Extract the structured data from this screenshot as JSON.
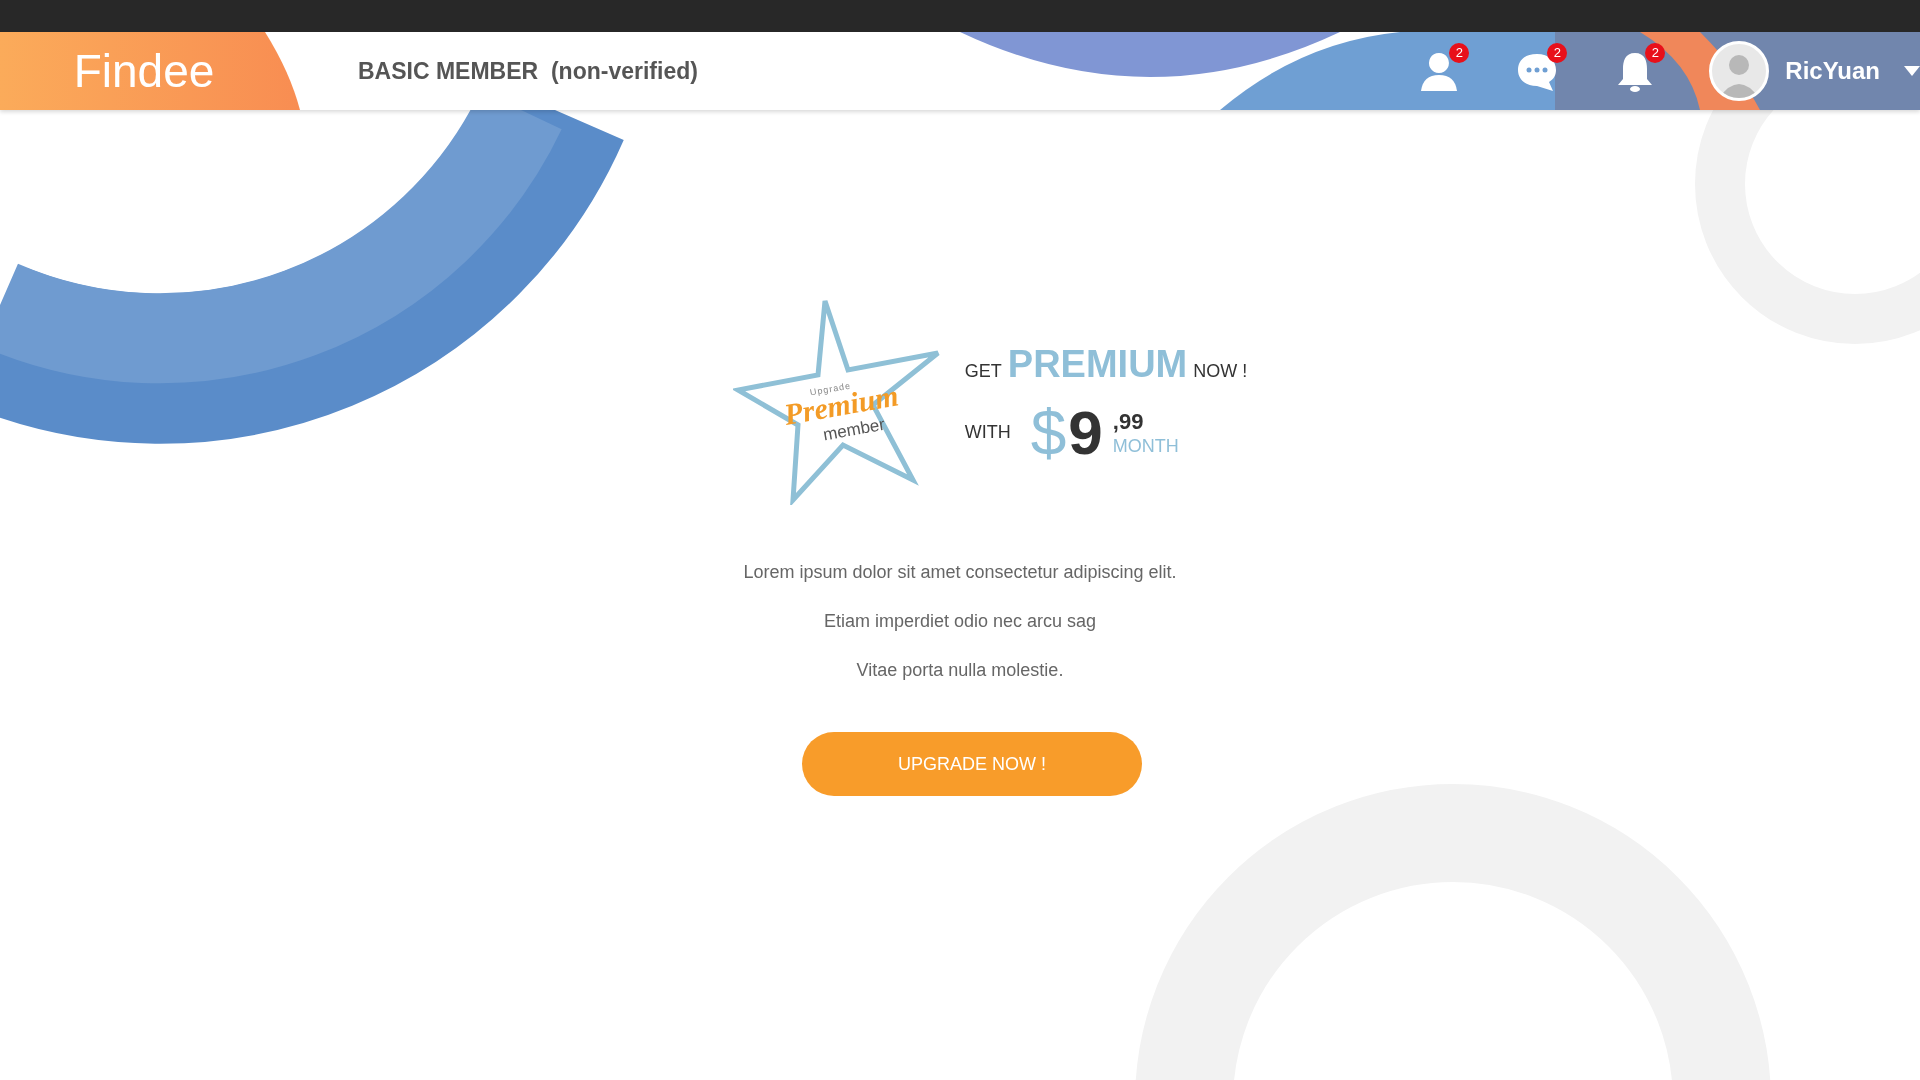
{
  "header": {
    "logo": "Findee",
    "membership": "BASIC MEMBER  (non-verified)",
    "icons": [
      {
        "kind": "contacts",
        "badge": "2"
      },
      {
        "kind": "messages",
        "badge": "2"
      },
      {
        "kind": "notifications",
        "badge": "2"
      }
    ],
    "user": {
      "name": "RicYuan"
    }
  },
  "offer": {
    "badge": {
      "small": "Upgrade",
      "title": "Premium",
      "subtitle": "member"
    },
    "get": "GET",
    "premium": "PREMIUM",
    "now": "NOW !",
    "with": "WITH",
    "currency": "$",
    "price": "9",
    "cents": ",99",
    "period": "MONTH"
  },
  "paragraphs": [
    "Lorem ipsum dolor sit amet consectetur adipiscing elit.",
    "Etiam imperdiet odio nec arcu sag",
    "Vitae porta nulla molestie."
  ],
  "button": "UPGRADE NOW !"
}
